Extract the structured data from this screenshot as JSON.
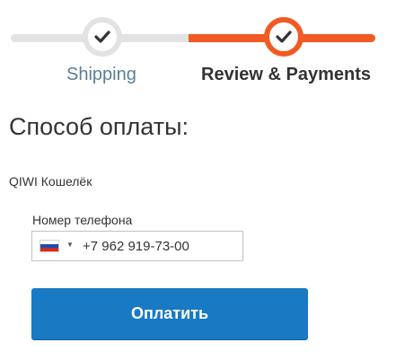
{
  "steps": [
    {
      "label": "Shipping",
      "state": "complete",
      "icon": "checkmark-icon"
    },
    {
      "label": "Review & Payments",
      "state": "current",
      "icon": "checkmark-icon"
    }
  ],
  "payment": {
    "title": "Способ оплаты:",
    "method": "QIWI Кошелёк",
    "phone_label": "Номер телефона",
    "phone_value": "+7 962 919-73-00",
    "country_flag": "russia-flag-icon",
    "submit_label": "Оплатить"
  },
  "colors": {
    "accent": "#f15a22",
    "inactive": "#e2e2e2",
    "button": "#1979c3",
    "step_link": "#5a7f97"
  }
}
